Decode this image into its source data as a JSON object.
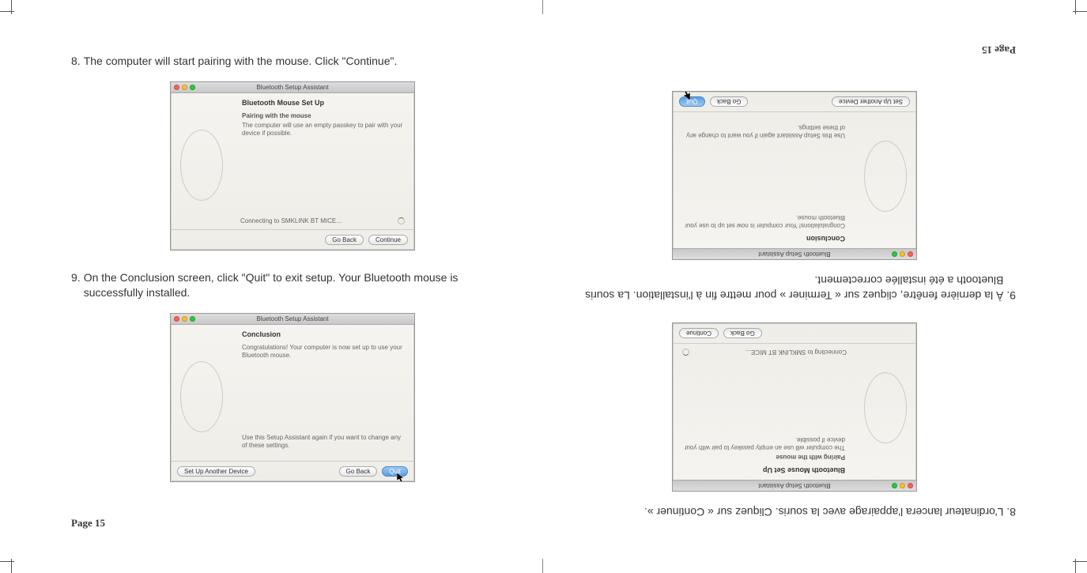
{
  "page_label": "Page 15",
  "left": {
    "step8": {
      "num": "8.",
      "text": "The computer will start pairing with the mouse. Click \"Continue\"."
    },
    "step9": {
      "num": "9.",
      "text": "On the Conclusion screen, click \"Quit\" to exit setup. Your Bluetooth mouse is successfully installed."
    },
    "shot_pairing": {
      "title": "Bluetooth Setup Assistant",
      "heading": "Bluetooth Mouse Set Up",
      "sub": "Pairing with the mouse",
      "body": "The computer will use an empty passkey to pair with your device if possible.",
      "status": "Connecting to SMKLINK BT MICE...",
      "back": "Go Back",
      "cont": "Continue"
    },
    "shot_conclusion": {
      "title": "Bluetooth Setup Assistant",
      "heading": "Conclusion",
      "body1": "Congratulations! Your computer is now set up to use your Bluetooth mouse.",
      "body2": "Use this Setup Assistant again if you want to change any of these settings.",
      "setup": "Set Up Another Device",
      "back": "Go Back",
      "quit": "Quit"
    }
  },
  "right": {
    "step8": {
      "num": "8.",
      "text": "L'ordinateur lancera l'appairage avec la souris. Cliquez sur « Continuer »."
    },
    "step9": {
      "num": "9.",
      "text": "À la dernière fenêtre, cliquez sur « Terminer » pour mettre fin à l'installation. La souris Bluetooth a été installée correctement."
    },
    "shot_pairing": {
      "title": "Bluetooth Setup Assistant",
      "heading": "Bluetooth Mouse Set Up",
      "sub": "Pairing with the mouse",
      "body": "The computer will use an empty passkey to pair with your device if possible.",
      "status": "Connecting to SMKLINK BT MICE...",
      "back": "Go Back",
      "cont": "Continue"
    },
    "shot_conclusion": {
      "title": "Bluetooth Setup Assistant",
      "heading": "Conclusion",
      "body1": "Congratulations! Your computer is now set up to use your Bluetooth mouse.",
      "body2": "Use this Setup Assistant again if you want to change any of these settings.",
      "setup": "Set Up Another Device",
      "back": "Go Back",
      "quit": "Quit"
    }
  }
}
